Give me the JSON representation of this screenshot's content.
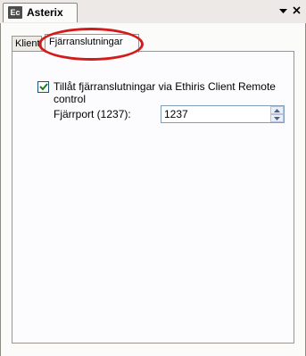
{
  "window": {
    "title": "Asterix",
    "app_icon_label": "Ec",
    "dropdown_icon": "chevron-down-icon",
    "close_icon": "close-icon"
  },
  "tabs": [
    {
      "label": "Klient",
      "active": false
    },
    {
      "label": "Fjärranslutningar",
      "active": true
    }
  ],
  "settings": {
    "allow_remote": {
      "label": "Tillåt fjärranslutningar via Ethiris Client Remote control",
      "checked": true
    },
    "remote_port": {
      "label": "Fjärrport (1237):",
      "value": "1237"
    }
  },
  "annotation": {
    "color": "#d21c1c",
    "shape": "ellipse-highlight"
  }
}
